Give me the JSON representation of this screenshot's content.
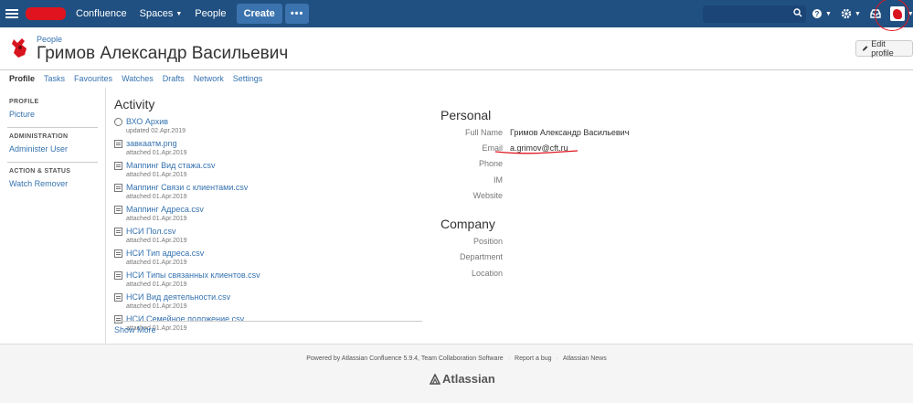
{
  "header": {
    "app_name": "Confluence",
    "spaces_label": "Spaces",
    "people_label": "People",
    "create_label": "Create",
    "more_label": "•••",
    "search_placeholder": "",
    "colors": {
      "bar": "#205081",
      "button": "#3b73af"
    }
  },
  "profile": {
    "breadcrumb": "People",
    "name": "Гримов Александр Васильевич",
    "edit_label": "Edit profile"
  },
  "tabs": [
    {
      "label": "Profile",
      "active": true
    },
    {
      "label": "Tasks"
    },
    {
      "label": "Favourites"
    },
    {
      "label": "Watches"
    },
    {
      "label": "Drafts"
    },
    {
      "label": "Network"
    },
    {
      "label": "Settings"
    }
  ],
  "sidebar": {
    "profile_heading": "PROFILE",
    "picture": "Picture",
    "admin_heading": "ADMINISTRATION",
    "administer_user": "Administer User",
    "action_heading": "ACTION & STATUS",
    "watch_remover": "Watch Remover"
  },
  "activity": {
    "title": "Activity",
    "items": [
      {
        "name": "ВХО Архив",
        "meta": "updated 02.Apr.2019",
        "icon": "page-icon"
      },
      {
        "name": "завкаатм.png",
        "meta": "attached 01.Apr.2019",
        "icon": "image-icon"
      },
      {
        "name": "Маппинг Вид стажа.csv",
        "meta": "attached 01.Apr.2019",
        "icon": "file-icon"
      },
      {
        "name": "Маппинг Связи с клиентами.csv",
        "meta": "attached 01.Apr.2019",
        "icon": "file-icon"
      },
      {
        "name": "Маппинг Адреса.csv",
        "meta": "attached 01.Apr.2019",
        "icon": "file-icon"
      },
      {
        "name": "НСИ Пол.csv",
        "meta": "attached 01.Apr.2019",
        "icon": "file-icon"
      },
      {
        "name": "НСИ Тип адреса.csv",
        "meta": "attached 01.Apr.2019",
        "icon": "file-icon"
      },
      {
        "name": "НСИ Типы связанных клиентов.csv",
        "meta": "attached 01.Apr.2019",
        "icon": "file-icon"
      },
      {
        "name": "НСИ Вид деятельности.csv",
        "meta": "attached 01.Apr.2019",
        "icon": "file-icon"
      },
      {
        "name": "НСИ Семейное положение.csv",
        "meta": "attached 01.Apr.2019",
        "icon": "file-icon"
      }
    ],
    "show_more": "Show More"
  },
  "personal": {
    "title": "Personal",
    "full_name_label": "Full Name",
    "full_name_value": "Гримов Александр Васильевич",
    "email_label": "Email",
    "email_value": "a.grimov@cft.ru",
    "phone_label": "Phone",
    "im_label": "IM",
    "website_label": "Website"
  },
  "company": {
    "title": "Company",
    "position_label": "Position",
    "department_label": "Department",
    "location_label": "Location"
  },
  "footer": {
    "powered": "Powered by Atlassian Confluence 5.9.4, Team Collaboration Software",
    "report_bug": "Report a bug",
    "news": "Atlassian News",
    "logo_text": "Atlassian"
  }
}
